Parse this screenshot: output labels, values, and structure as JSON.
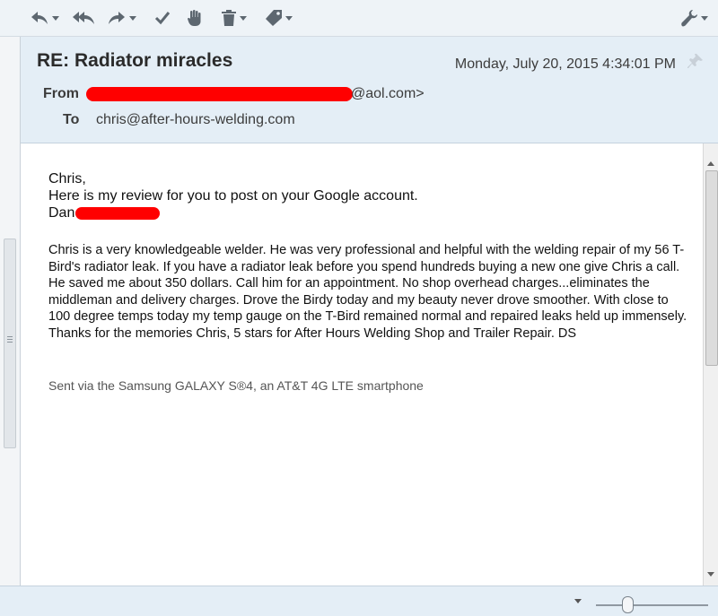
{
  "toolbar": {
    "icons": [
      "reply-icon",
      "reply-all-icon",
      "forward-icon",
      "checkmark-icon",
      "hand-icon",
      "trash-icon",
      "tag-icon",
      "wrench-icon"
    ]
  },
  "email": {
    "subject": "RE: Radiator miracles",
    "date": "Monday, July 20, 2015 4:34:01 PM",
    "from_label": "From",
    "from_value_visible": "@aol.com>",
    "to_label": "To",
    "to_value": "chris@after-hours-welding.com",
    "body": {
      "greeting": "Chris,",
      "line2": "Here is my review for you to post on your Google account.",
      "signature_visible": "Dan",
      "review": "Chris is a very knowledgeable welder. He was very professional and helpful with the welding repair of my 56 T-Bird's radiator leak. If you have a radiator leak before you spend hundreds buying a new one give Chris a call. He saved me about 350 dollars. Call him for an appointment. No shop overhead charges...eliminates the middleman and delivery charges. Drove the Birdy today and my beauty never drove smoother. With close to 100 degree temps today my temp gauge on the T-Bird remained normal and repaired leaks held up immensely. Thanks for the memories Chris, 5 stars for After Hours Welding Shop and Trailer Repair. DS",
      "sent_via": "Sent via the Samsung GALAXY S®4, an AT&T 4G LTE smartphone"
    }
  },
  "colors": {
    "header_bg": "#e4eef6",
    "toolbar_bg": "#eef3f7",
    "redaction": "#ff0000",
    "icon": "#5d6770"
  }
}
